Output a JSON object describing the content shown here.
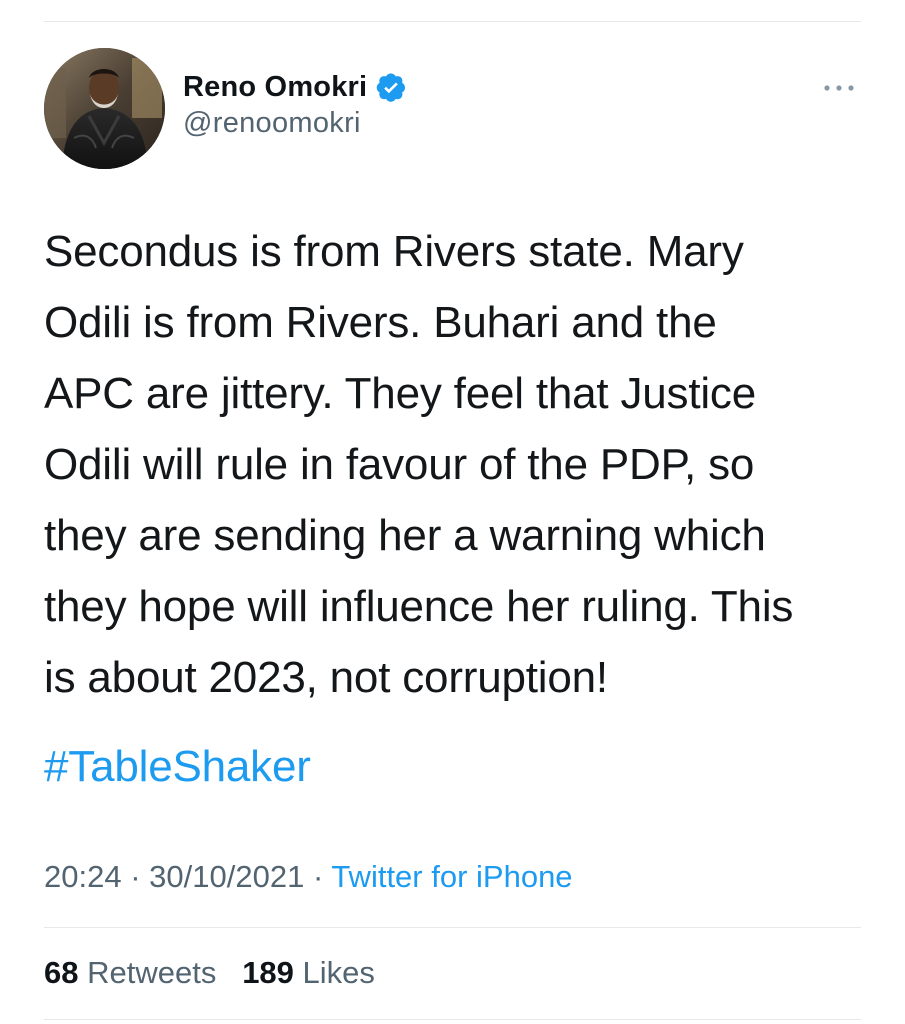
{
  "tweet": {
    "author": {
      "display_name": "Reno Omokri",
      "handle": "@renoomokri",
      "verified": true,
      "verified_icon": "verified-badge-icon",
      "avatar": "profile-photo"
    },
    "more_icon": "more-horizontal-icon",
    "text": "Secondus is from Rivers state. Mary\nOdili is from Rivers. Buhari and the\nAPC are jittery. They feel that Justice\nOdili will rule in favour of the PDP, so\nthey are sending her a warning which\nthey hope will influence her ruling. This\nis about 2023, not corruption!",
    "hashtag": "#TableShaker",
    "time": "20:24",
    "separator": "·",
    "date": "30/10/2021",
    "source": "Twitter for iPhone",
    "stats": {
      "retweets_count": "68",
      "retweets_label": "Retweets",
      "likes_count": "189",
      "likes_label": "Likes"
    },
    "colors": {
      "link": "#1d9bf0",
      "secondary_text": "#536471",
      "primary_text": "#0f1419"
    }
  }
}
